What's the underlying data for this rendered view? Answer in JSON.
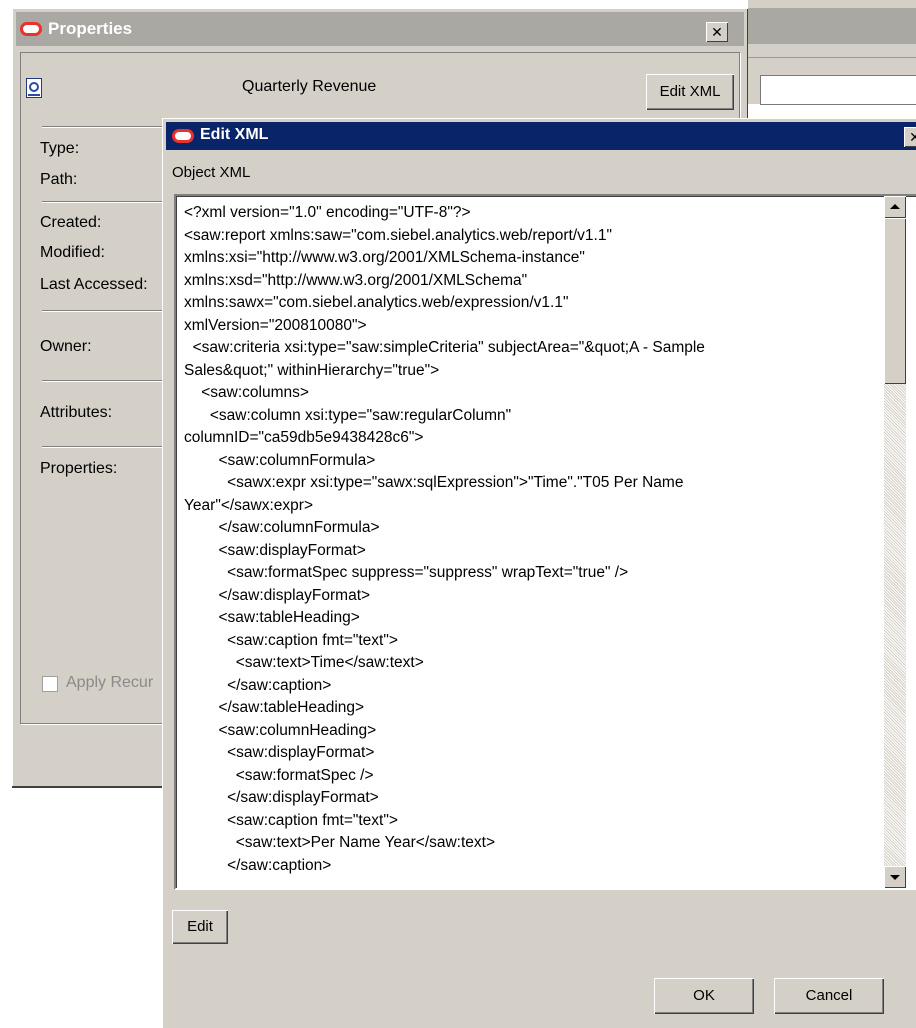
{
  "properties_dialog": {
    "title": "Properties",
    "object_name": "Quarterly Revenue",
    "edit_xml_button": "Edit XML",
    "labels": {
      "type": "Type:",
      "path": "Path:",
      "created": "Created:",
      "modified": "Modified:",
      "last_accessed": "Last Accessed:",
      "owner": "Owner:",
      "attributes": "Attributes:",
      "properties": "Properties:"
    },
    "apply_recursive_label": "Apply Recur",
    "apply_recursive_checked": false
  },
  "edit_xml_dialog": {
    "title": "Edit XML",
    "object_xml_label": "Object XML",
    "xml_content": "<?xml version=\"1.0\" encoding=\"UTF-8\"?>\n<saw:report xmlns:saw=\"com.siebel.analytics.web/report/v1.1\"\nxmlns:xsi=\"http://www.w3.org/2001/XMLSchema-instance\"\nxmlns:xsd=\"http://www.w3.org/2001/XMLSchema\"\nxmlns:sawx=\"com.siebel.analytics.web/expression/v1.1\"\nxmlVersion=\"200810080\">\n  <saw:criteria xsi:type=\"saw:simpleCriteria\" subjectArea=\"&quot;A - Sample\nSales&quot;\" withinHierarchy=\"true\">\n    <saw:columns>\n      <saw:column xsi:type=\"saw:regularColumn\"\ncolumnID=\"ca59db5e9438428c6\">\n        <saw:columnFormula>\n          <sawx:expr xsi:type=\"sawx:sqlExpression\">\"Time\".\"T05 Per Name\nYear\"</sawx:expr>\n        </saw:columnFormula>\n        <saw:displayFormat>\n          <saw:formatSpec suppress=\"suppress\" wrapText=\"true\" />\n        </saw:displayFormat>\n        <saw:tableHeading>\n          <saw:caption fmt=\"text\">\n            <saw:text>Time</saw:text>\n          </saw:caption>\n        </saw:tableHeading>\n        <saw:columnHeading>\n          <saw:displayFormat>\n            <saw:formatSpec />\n          </saw:displayFormat>\n          <saw:caption fmt=\"text\">\n            <saw:text>Per Name Year</saw:text>\n          </saw:caption>",
    "edit_button": "Edit",
    "ok_button": "OK",
    "cancel_button": "Cancel",
    "close_glyph": "✕"
  },
  "properties_close_glyph": "✕"
}
